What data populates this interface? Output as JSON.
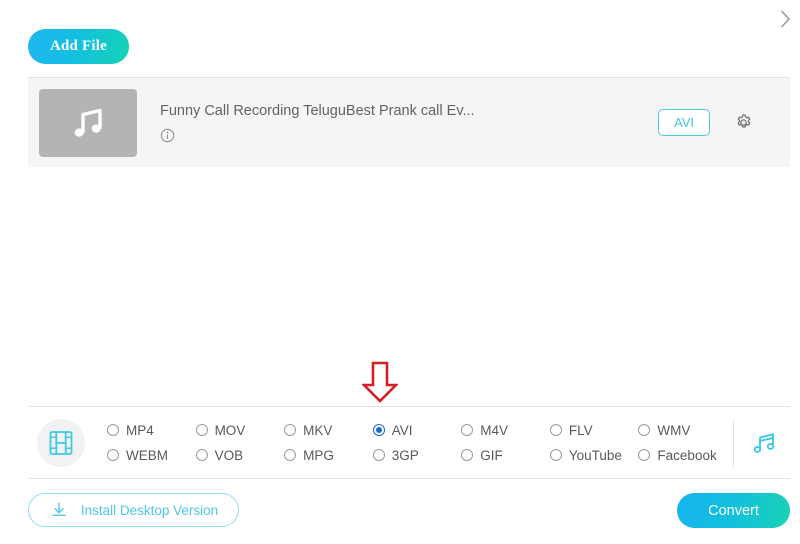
{
  "header": {
    "chevron_icon": "chevron-right-icon",
    "add_file_label": "Add File"
  },
  "file_row": {
    "thumb_icon": "music-note-icon",
    "name": "Funny Call Recording TeluguBest Prank call Ev...",
    "info_icon": "info-circle-icon",
    "format_badge": "AVI",
    "settings_icon": "gear-icon"
  },
  "annotation": {
    "arrow_icon": "arrow-down-icon",
    "arrow_color": "#d42027"
  },
  "formats": {
    "video_icon": "film-strip-icon",
    "audio_icon": "music-note-icon",
    "selected": "AVI",
    "options": [
      {
        "label": "MP4",
        "checked": false
      },
      {
        "label": "MOV",
        "checked": false
      },
      {
        "label": "MKV",
        "checked": false
      },
      {
        "label": "AVI",
        "checked": true
      },
      {
        "label": "M4V",
        "checked": false
      },
      {
        "label": "FLV",
        "checked": false
      },
      {
        "label": "WMV",
        "checked": false
      },
      {
        "label": "WEBM",
        "checked": false
      },
      {
        "label": "VOB",
        "checked": false
      },
      {
        "label": "MPG",
        "checked": false
      },
      {
        "label": "3GP",
        "checked": false
      },
      {
        "label": "GIF",
        "checked": false
      },
      {
        "label": "YouTube",
        "checked": false
      },
      {
        "label": "Facebook",
        "checked": false
      }
    ]
  },
  "footer": {
    "install_label": "Install Desktop Version",
    "install_icon": "download-icon",
    "convert_label": "Convert"
  },
  "colors": {
    "accent_cyan": "#3ec8e6",
    "radio_blue": "#1567d3",
    "annotation_red": "#d42027",
    "row_bg": "#f5f5f5"
  }
}
